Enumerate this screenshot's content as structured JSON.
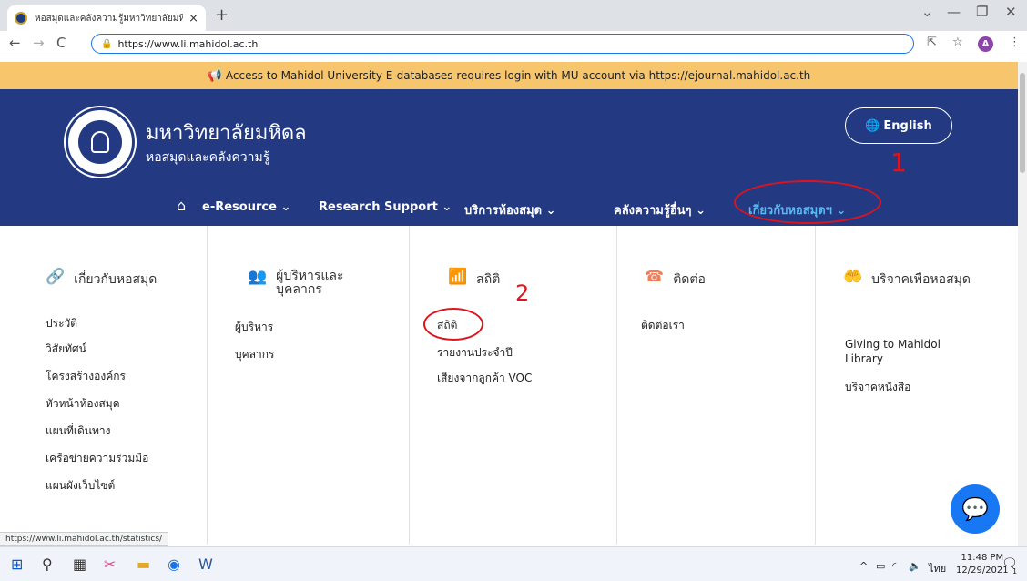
{
  "browser": {
    "tab_title": "หอสมุดและคลังความรู้มหาวิทยาลัยมหิดล",
    "tab_close": "×",
    "new_tab": "+",
    "url": "https://www.li.mahidol.ac.th",
    "avatar_letter": "A",
    "status_url": "https://www.li.mahidol.ac.th/statistics/"
  },
  "notice": {
    "text": "Access to Mahidol University E-databases requires login with MU account via https://ejournal.mahidol.ac.th"
  },
  "header": {
    "site_name": "มหาวิทยาลัยมหิดล",
    "site_sub": "หอสมุดและคลังความรู้",
    "lang_button": "English",
    "annotation_1": "1"
  },
  "nav": {
    "items": [
      {
        "label": "e-Resource"
      },
      {
        "label": "Research Support"
      },
      {
        "label": "บริการห้องสมุด"
      },
      {
        "label": "คลังความรู้อื่นๆ"
      },
      {
        "label": "เกี่ยวกับหอสมุดฯ"
      }
    ]
  },
  "mega": {
    "annotation_2": "2",
    "columns": [
      {
        "heading": "เกี่ยวกับหอสมุด",
        "icon": "link-icon",
        "links": [
          "ประวัติ",
          "วิสัยทัศน์",
          "โครงสร้างองค์กร",
          "หัวหน้าห้องสมุด",
          "แผนที่เดินทาง",
          "เครือข่ายความร่วมมือ",
          "แผนผังเว็บไซต์"
        ]
      },
      {
        "heading": "ผู้บริหารและบุคลากร",
        "icon": "people-icon",
        "links": [
          "ผู้บริหาร",
          "บุคลากร"
        ]
      },
      {
        "heading": "สถิติ",
        "icon": "bar-chart-icon",
        "links": [
          "สถิติ",
          "รายงานประจำปี",
          "เสียงจากลูกค้า VOC"
        ]
      },
      {
        "heading": "ติดต่อ",
        "icon": "phone-icon",
        "links": [
          "ติดต่อเรา"
        ]
      },
      {
        "heading": "บริจาคเพื่อหอสมุด",
        "icon": "hands-icon",
        "links": [
          "Giving to Mahidol Library",
          "บริจาคหนังสือ"
        ]
      }
    ]
  },
  "taskbar": {
    "lang": "ไทย",
    "time": "11:48 PM",
    "date": "12/29/2021",
    "notif_count": "1"
  }
}
